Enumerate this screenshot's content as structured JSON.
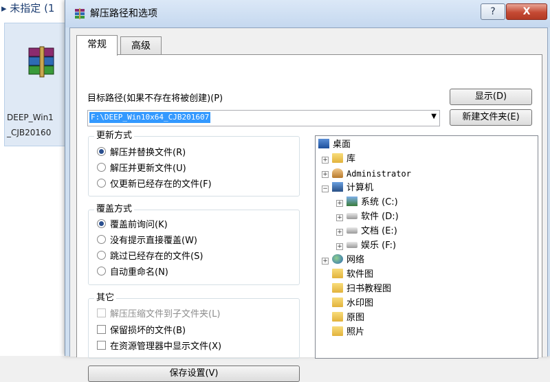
{
  "background": {
    "header_text": "▸ 未指定 (1",
    "file_name_line1": "DEEP_Win1",
    "file_name_line2": "_CJB20160"
  },
  "dialog": {
    "title": "解压路径和选项",
    "help_label": "?",
    "close_label": "X",
    "tabs": [
      {
        "label": "常规",
        "active": true
      },
      {
        "label": "高级",
        "active": false
      }
    ],
    "target_path_label": "目标路径(如果不存在将被创建)(P)",
    "target_path_value": "F:\\DEEP_Win10x64_CJB201607",
    "show_button": "显示(D)",
    "new_folder_button": "新建文件夹(E)",
    "update_mode": {
      "title": "更新方式",
      "options": [
        {
          "label": "解压并替换文件(R)",
          "selected": true
        },
        {
          "label": "解压并更新文件(U)",
          "selected": false
        },
        {
          "label": "仅更新已经存在的文件(F)",
          "selected": false
        }
      ]
    },
    "overwrite_mode": {
      "title": "覆盖方式",
      "options": [
        {
          "label": "覆盖前询问(K)",
          "selected": true
        },
        {
          "label": "没有提示直接覆盖(W)",
          "selected": false
        },
        {
          "label": "跳过已经存在的文件(S)",
          "selected": false
        },
        {
          "label": "自动重命名(N)",
          "selected": false
        }
      ]
    },
    "misc": {
      "title": "其它",
      "options": [
        {
          "label": "解压压缩文件到子文件夹(L)",
          "checked": false,
          "disabled": true
        },
        {
          "label": "保留损坏的文件(B)",
          "checked": false,
          "disabled": false
        },
        {
          "label": "在资源管理器中显示文件(X)",
          "checked": false,
          "disabled": false
        }
      ]
    },
    "save_settings_button": "保存设置(V)",
    "tree": {
      "desktop": "桌面",
      "library": "库",
      "user": "Administrator",
      "computer": "计算机",
      "drives": [
        {
          "label": "系统 (C:)"
        },
        {
          "label": "软件 (D:)"
        },
        {
          "label": "文档 (E:)"
        },
        {
          "label": "娱乐 (F:)"
        }
      ],
      "network": "网络",
      "folders": [
        "软件图",
        "扫书教程图",
        "水印图",
        "原图",
        "照片"
      ]
    }
  }
}
